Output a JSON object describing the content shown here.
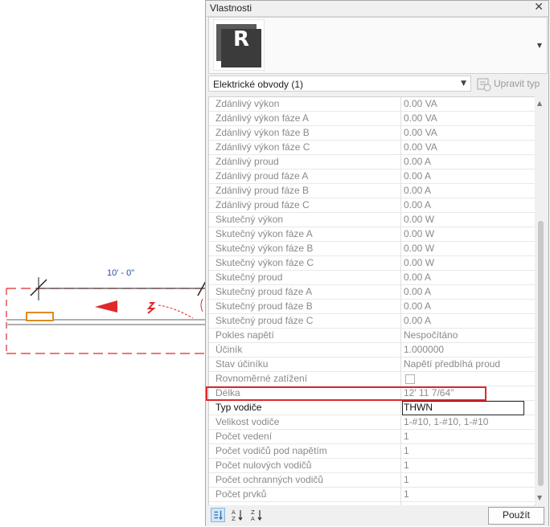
{
  "drawing": {
    "dimension_label": "10' - 0\"",
    "colors": {
      "dimension": "#1f4fa8",
      "circuit": "#e0282b",
      "device": "#e08a1e",
      "wire": "#b0b0b0"
    }
  },
  "palette": {
    "title": "Vlastnosti",
    "close_icon": "close-icon",
    "logo_letter": "R",
    "type_selector": "Elektrické obvody (1)",
    "edit_type_label": "Upravit typ",
    "apply_label": "Použít",
    "highlight_color": "#e0282b",
    "rows": [
      {
        "name": "Zdánlivý výkon",
        "value": "0.00 VA"
      },
      {
        "name": "Zdánlivý výkon fáze A",
        "value": "0.00 VA"
      },
      {
        "name": "Zdánlivý výkon fáze B",
        "value": "0.00 VA"
      },
      {
        "name": "Zdánlivý výkon fáze C",
        "value": "0.00 VA"
      },
      {
        "name": "Zdánlivý proud",
        "value": "0.00 A"
      },
      {
        "name": "Zdánlivý proud fáze A",
        "value": "0.00 A"
      },
      {
        "name": "Zdánlivý proud fáze B",
        "value": "0.00 A"
      },
      {
        "name": "Zdánlivý proud fáze C",
        "value": "0.00 A"
      },
      {
        "name": "Skutečný výkon",
        "value": "0.00 W"
      },
      {
        "name": "Skutečný výkon fáze A",
        "value": "0.00 W"
      },
      {
        "name": "Skutečný výkon fáze B",
        "value": "0.00 W"
      },
      {
        "name": "Skutečný výkon fáze C",
        "value": "0.00 W"
      },
      {
        "name": "Skutečný proud",
        "value": "0.00 A"
      },
      {
        "name": "Skutečný proud fáze A",
        "value": "0.00 A"
      },
      {
        "name": "Skutečný proud fáze B",
        "value": "0.00 A"
      },
      {
        "name": "Skutečný proud fáze C",
        "value": "0.00 A"
      },
      {
        "name": "Pokles napětí",
        "value": "Nespočítáno"
      },
      {
        "name": "Účiník",
        "value": "1.000000"
      },
      {
        "name": "Stav účiníku",
        "value": "Napětí předbíhá proud"
      },
      {
        "name": "Rovnoměrné zatížení",
        "value": "",
        "checkbox": true
      },
      {
        "name": "Délka",
        "value": "12'  11 7/64\""
      },
      {
        "name": "Typ vodiče",
        "value": "THWN",
        "editable": true
      },
      {
        "name": "Velikost vodiče",
        "value": "1-#10, 1-#10, 1-#10"
      },
      {
        "name": "Počet vedení",
        "value": "1"
      },
      {
        "name": "Počet vodičů pod napětím",
        "value": "1"
      },
      {
        "name": "Počet nulových vodičů",
        "value": "1"
      },
      {
        "name": "Počet ochranných vodičů",
        "value": "1"
      },
      {
        "name": "Počet prvků",
        "value": "1"
      },
      {
        "name": "",
        "value": ""
      }
    ]
  }
}
